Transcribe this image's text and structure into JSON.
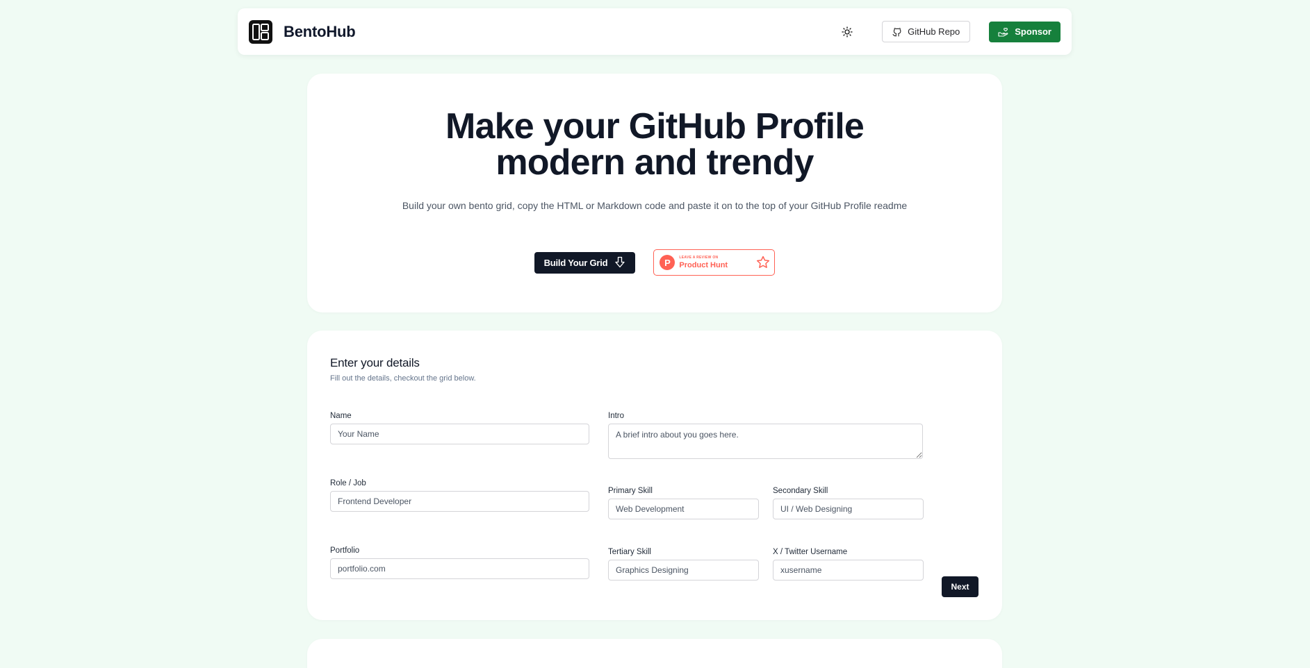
{
  "navbar": {
    "brand": "BentoHub",
    "theme_toggle_icon": "sun-icon",
    "repo_label": "GitHub Repo",
    "sponsor_label": "Sponsor"
  },
  "hero": {
    "title_line1": "Make your GitHub Profile",
    "title_line2": "modern and trendy",
    "subtitle": "Build your own bento grid, copy the HTML or Markdown code and paste it on to the top of your GitHub Profile readme",
    "build_label": "Build Your Grid",
    "ph_small": "LEAVE A REVIEW ON",
    "ph_big": "Product Hunt"
  },
  "form": {
    "title": "Enter your details",
    "subtitle": "Fill out the details, checkout the grid below.",
    "fields": {
      "name": {
        "label": "Name",
        "placeholder": "Your Name"
      },
      "intro": {
        "label": "Intro",
        "placeholder": "A brief intro about you goes here."
      },
      "role": {
        "label": "Role / Job",
        "placeholder": "Frontend Developer"
      },
      "primary": {
        "label": "Primary Skill",
        "placeholder": "Web Development"
      },
      "secondary": {
        "label": "Secondary Skill",
        "placeholder": "UI / Web Designing"
      },
      "portfolio": {
        "label": "Portfolio",
        "placeholder": "portfolio.com"
      },
      "tertiary": {
        "label": "Tertiary Skill",
        "placeholder": "Graphics Designing"
      },
      "twitter": {
        "label": "X / Twitter Username",
        "placeholder": "xusername"
      }
    },
    "next_label": "Next"
  },
  "colors": {
    "background": "#f0fbf4",
    "sponsor": "#16803c",
    "primary_dark": "#111827",
    "product_hunt": "#ff6154"
  }
}
